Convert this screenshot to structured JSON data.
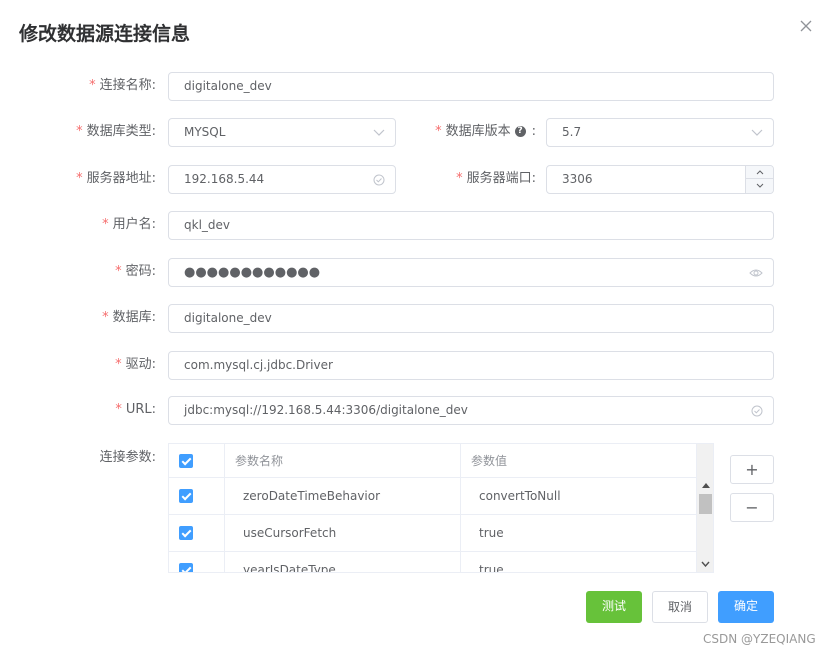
{
  "dialog": {
    "title": "修改数据源连接信息"
  },
  "form": {
    "conn_name": {
      "label": "连接名称:",
      "value": "digitalone_dev"
    },
    "db_type": {
      "label": "数据库类型:",
      "value": "MYSQL"
    },
    "db_version": {
      "label": "数据库版本",
      "help": "?",
      "colon": ":",
      "value": "5.7"
    },
    "server_addr": {
      "label": "服务器地址:",
      "value": "192.168.5.44"
    },
    "server_port": {
      "label": "服务器端口:",
      "value": "3306"
    },
    "username": {
      "label": "用户名:",
      "value": "qkl_dev"
    },
    "password": {
      "label": "密码:",
      "value": "●●●●●●●●●●●●"
    },
    "database": {
      "label": "数据库:",
      "value": "digitalone_dev"
    },
    "driver": {
      "label": "驱动:",
      "value": "com.mysql.cj.jdbc.Driver"
    },
    "url": {
      "label": "URL:",
      "value": "jdbc:mysql://192.168.5.44:3306/digitalone_dev"
    },
    "params_label": "连接参数:"
  },
  "required_mark": "*",
  "params_table": {
    "headers": [
      "参数名称",
      "参数值"
    ],
    "rows": [
      {
        "name": "zeroDateTimeBehavior",
        "value": "convertToNull"
      },
      {
        "name": "useCursorFetch",
        "value": "true"
      },
      {
        "name": "yearIsDateType",
        "value": "true"
      }
    ]
  },
  "side_buttons": {
    "add": "+",
    "remove": "−"
  },
  "buttons": {
    "test": "测试",
    "cancel": "取消",
    "confirm": "确定"
  },
  "colors": {
    "primary": "#409eff",
    "success": "#67c23a",
    "required": "#f56c6c"
  },
  "watermark": "CSDN @YZEQIANG"
}
